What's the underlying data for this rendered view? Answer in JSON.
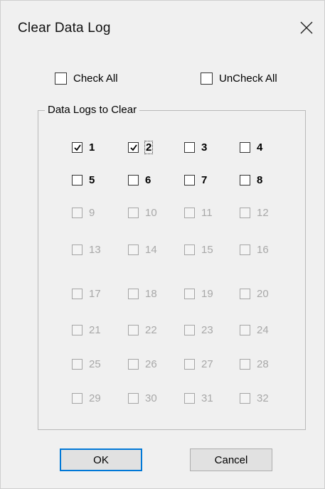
{
  "dialog": {
    "title": "Clear Data Log"
  },
  "top_checks": {
    "check_all": "Check All",
    "uncheck_all": "UnCheck All"
  },
  "group": {
    "title": "Data Logs to Clear"
  },
  "logs": [
    {
      "label": "1",
      "checked": true,
      "enabled": true
    },
    {
      "label": "2",
      "checked": true,
      "enabled": true
    },
    {
      "label": "3",
      "checked": false,
      "enabled": true
    },
    {
      "label": "4",
      "checked": false,
      "enabled": true
    },
    {
      "label": "5",
      "checked": false,
      "enabled": true
    },
    {
      "label": "6",
      "checked": false,
      "enabled": true
    },
    {
      "label": "7",
      "checked": false,
      "enabled": true
    },
    {
      "label": "8",
      "checked": false,
      "enabled": true
    },
    {
      "label": "9",
      "checked": false,
      "enabled": false
    },
    {
      "label": "10",
      "checked": false,
      "enabled": false
    },
    {
      "label": "11",
      "checked": false,
      "enabled": false
    },
    {
      "label": "12",
      "checked": false,
      "enabled": false
    },
    {
      "label": "13",
      "checked": false,
      "enabled": false
    },
    {
      "label": "14",
      "checked": false,
      "enabled": false
    },
    {
      "label": "15",
      "checked": false,
      "enabled": false
    },
    {
      "label": "16",
      "checked": false,
      "enabled": false
    },
    {
      "label": "17",
      "checked": false,
      "enabled": false
    },
    {
      "label": "18",
      "checked": false,
      "enabled": false
    },
    {
      "label": "19",
      "checked": false,
      "enabled": false
    },
    {
      "label": "20",
      "checked": false,
      "enabled": false
    },
    {
      "label": "21",
      "checked": false,
      "enabled": false
    },
    {
      "label": "22",
      "checked": false,
      "enabled": false
    },
    {
      "label": "23",
      "checked": false,
      "enabled": false
    },
    {
      "label": "24",
      "checked": false,
      "enabled": false
    },
    {
      "label": "25",
      "checked": false,
      "enabled": false
    },
    {
      "label": "26",
      "checked": false,
      "enabled": false
    },
    {
      "label": "27",
      "checked": false,
      "enabled": false
    },
    {
      "label": "28",
      "checked": false,
      "enabled": false
    },
    {
      "label": "29",
      "checked": false,
      "enabled": false
    },
    {
      "label": "30",
      "checked": false,
      "enabled": false
    },
    {
      "label": "31",
      "checked": false,
      "enabled": false
    },
    {
      "label": "32",
      "checked": false,
      "enabled": false
    }
  ],
  "buttons": {
    "ok": "OK",
    "cancel": "Cancel"
  },
  "colors": {
    "background": "#f0f0f0",
    "disabled_text": "#a8a8a8",
    "default_button_border": "#0078d7"
  }
}
